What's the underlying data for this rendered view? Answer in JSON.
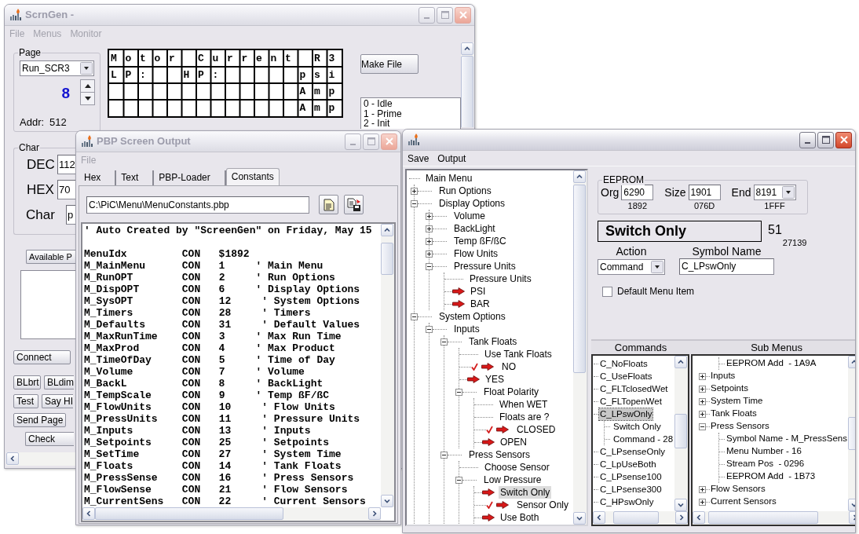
{
  "scrngen": {
    "title": "ScrnGen -",
    "active": false,
    "menu": [
      {
        "label": "File",
        "disabled": true
      },
      {
        "label": "Menus",
        "disabled": true
      },
      {
        "label": "Monitor",
        "disabled": true
      }
    ],
    "page": {
      "label": "Page",
      "value": "Run_SCR3",
      "number": "8",
      "addr_label": "Addr:",
      "addr": "512"
    },
    "lcd": [
      "Motor Current R3",
      "LP:  HP:     psi",
      "             Amp",
      "             Amp"
    ],
    "make_file": "Make File",
    "states": [
      "0 - Idle",
      "1 - Prime",
      "2 - Init"
    ],
    "char": {
      "label": "Char",
      "fields": [
        {
          "label": "DEC",
          "value": "112"
        },
        {
          "label": "HEX",
          "value": "70"
        },
        {
          "label": "Char",
          "value": "p"
        }
      ]
    },
    "available_button": "Available P",
    "buttons": [
      [
        "Connect"
      ],
      [
        "BLbrt",
        "BLdim"
      ],
      [
        "Test",
        "Say HI"
      ],
      [
        "Send Page"
      ],
      [
        "Check"
      ]
    ]
  },
  "pbp_output": {
    "title": "PBP Screen Output",
    "active": false,
    "menu": [
      {
        "label": "File",
        "disabled": true
      }
    ],
    "tabs": [
      {
        "label": "Hex",
        "selected": false
      },
      {
        "label": "Text",
        "selected": false
      },
      {
        "label": "PBP-Loader",
        "selected": false
      },
      {
        "label": "Constants",
        "selected": true
      }
    ],
    "path": "C:\\PiC\\Menu\\MenuConstants.pbp",
    "header": "' Auto Created by \"ScreenGen\" on Friday, May 15",
    "constants": [
      {
        "name": "MenuIdx",
        "keyword": "CON",
        "value": "$1892"
      },
      {
        "name": "M_MainMenu",
        "keyword": "CON",
        "value": "1",
        "comment": "' Main Menu"
      },
      {
        "name": "M_RunOPT",
        "keyword": "CON",
        "value": "2",
        "comment": "' Run Options"
      },
      {
        "name": "M_DispOPT",
        "keyword": "CON",
        "value": "6",
        "comment": "' Display Options"
      },
      {
        "name": "M_SysOPT",
        "keyword": "CON",
        "value": "12",
        "comment": "' System Options"
      },
      {
        "name": "M_Timers",
        "keyword": "CON",
        "value": "28",
        "comment": "' Timers"
      },
      {
        "name": "M_Defaults",
        "keyword": "CON",
        "value": "31",
        "comment": "' Default Values"
      },
      {
        "name": "M_MaxRunTime",
        "keyword": "CON",
        "value": "3",
        "comment": "' Max Run Time"
      },
      {
        "name": "M_MaxProd",
        "keyword": "CON",
        "value": "4",
        "comment": "' Max Product"
      },
      {
        "name": "M_TimeOfDay",
        "keyword": "CON",
        "value": "5",
        "comment": "' Time of Day"
      },
      {
        "name": "M_Volume",
        "keyword": "CON",
        "value": "7",
        "comment": "' Volume"
      },
      {
        "name": "M_BackL",
        "keyword": "CON",
        "value": "8",
        "comment": "' BackLight"
      },
      {
        "name": "M_TempScale",
        "keyword": "CON",
        "value": "9",
        "comment": "' Temp ßF/ßC"
      },
      {
        "name": "M_FlowUnits",
        "keyword": "CON",
        "value": "10",
        "comment": "' Flow Units"
      },
      {
        "name": "M_PressUnits",
        "keyword": "CON",
        "value": "11",
        "comment": "' Pressure Units"
      },
      {
        "name": "M_Inputs",
        "keyword": "CON",
        "value": "13",
        "comment": "' Inputs"
      },
      {
        "name": "M_Setpoints",
        "keyword": "CON",
        "value": "25",
        "comment": "' Setpoints"
      },
      {
        "name": "M_SetTime",
        "keyword": "CON",
        "value": "27",
        "comment": "' System Time"
      },
      {
        "name": "M_Floats",
        "keyword": "CON",
        "value": "14",
        "comment": "' Tank Floats"
      },
      {
        "name": "M_PressSense",
        "keyword": "CON",
        "value": "16",
        "comment": "' Press Sensors"
      },
      {
        "name": "M_FlowSense",
        "keyword": "CON",
        "value": "21",
        "comment": "' Flow Sensors"
      },
      {
        "name": "M_CurrentSens",
        "keyword": "CON",
        "value": "22",
        "comment": "' Current Sensors"
      }
    ]
  },
  "menu_editor": {
    "active": true,
    "menu": [
      {
        "label": "Save",
        "disabled": false
      },
      {
        "label": "Output",
        "disabled": false
      }
    ],
    "tree": [
      {
        "label": "Main Menu",
        "kind": "node",
        "selected": false,
        "children": [
          {
            "label": "Run Options",
            "kind": "node",
            "selected": false,
            "expanded": false
          },
          {
            "label": "Display Options",
            "kind": "node",
            "selected": false,
            "expanded": true,
            "children": [
              {
                "label": "Volume",
                "kind": "node",
                "selected": false,
                "expanded": false
              },
              {
                "label": "BackLight",
                "kind": "node",
                "selected": false,
                "expanded": false
              },
              {
                "label": "Temp ßF/ßC",
                "kind": "node",
                "selected": false,
                "expanded": false
              },
              {
                "label": "Flow Units",
                "kind": "node",
                "selected": false,
                "expanded": false
              },
              {
                "label": "Pressure Units",
                "kind": "node",
                "selected": false,
                "expanded": true,
                "children": [
                  {
                    "label": "Pressure Units",
                    "kind": "node",
                    "selected": false
                  },
                  {
                    "label": "PSI",
                    "kind": "option",
                    "selected": false,
                    "checked": false
                  },
                  {
                    "label": "BAR",
                    "kind": "option",
                    "selected": false,
                    "checked": false
                  }
                ]
              }
            ]
          },
          {
            "label": "System Options",
            "kind": "node",
            "selected": false,
            "expanded": true,
            "children": [
              {
                "label": "Inputs",
                "kind": "node",
                "selected": false,
                "expanded": true,
                "children": [
                  {
                    "label": "Tank Floats",
                    "kind": "node",
                    "selected": false,
                    "expanded": true,
                    "children": [
                      {
                        "label": "Use Tank Floats",
                        "kind": "node",
                        "selected": false
                      },
                      {
                        "label": "NO",
                        "kind": "option",
                        "selected": false,
                        "checked": true
                      },
                      {
                        "label": "YES",
                        "kind": "option",
                        "selected": false,
                        "checked": false
                      },
                      {
                        "label": "Float Polarity",
                        "kind": "node",
                        "selected": false,
                        "expanded": true,
                        "children": [
                          {
                            "label": "When WET",
                            "kind": "node",
                            "selected": false
                          },
                          {
                            "label": "Floats are ?",
                            "kind": "node",
                            "selected": false
                          },
                          {
                            "label": "CLOSED",
                            "kind": "option",
                            "selected": false,
                            "checked": true
                          },
                          {
                            "label": "OPEN",
                            "kind": "option",
                            "selected": false,
                            "checked": false
                          }
                        ]
                      }
                    ]
                  },
                  {
                    "label": "Press Sensors",
                    "kind": "node",
                    "selected": false,
                    "expanded": true,
                    "children": [
                      {
                        "label": "Choose Sensor",
                        "kind": "node",
                        "selected": false
                      },
                      {
                        "label": "Low Pressure",
                        "kind": "node",
                        "selected": false,
                        "expanded": true,
                        "children": [
                          {
                            "label": "Switch Only",
                            "kind": "option",
                            "selected": true,
                            "checked": false
                          },
                          {
                            "label": "Sensor Only",
                            "kind": "option",
                            "selected": false,
                            "checked": true
                          },
                          {
                            "label": "Use Both",
                            "kind": "option",
                            "selected": false,
                            "checked": false
                          }
                        ]
                      }
                    ]
                  }
                ]
              }
            ]
          }
        ]
      }
    ],
    "eeprom": {
      "label": "EEPROM",
      "fields": [
        {
          "label": "Org",
          "value": "6290",
          "hex": "1892",
          "kind": "text"
        },
        {
          "label": "Size",
          "value": "1901",
          "hex": "076D",
          "kind": "text"
        },
        {
          "label": "End",
          "value": "8191",
          "hex": "1FFF",
          "kind": "combo"
        }
      ]
    },
    "caption": "Switch Only",
    "count": "51",
    "code": "27139",
    "action": {
      "label": "Action",
      "value": "Command"
    },
    "symbol": {
      "label": "Symbol Name",
      "value": "C_LPswOnly"
    },
    "default_item": {
      "label": "Default Menu Item",
      "checked": false
    },
    "commands": {
      "label": "Commands",
      "items": [
        {
          "label": "C_NoFloats",
          "selected": false
        },
        {
          "label": "C_UseFloats",
          "selected": false
        },
        {
          "label": "C_FLTclosedWet",
          "selected": false
        },
        {
          "label": "C_FLTopenWet",
          "selected": false
        },
        {
          "label": "C_LPswOnly",
          "selected": true,
          "children": [
            {
              "label": "Switch Only",
              "selected": false
            },
            {
              "label": "Command - 28",
              "selected": false
            }
          ]
        },
        {
          "label": "C_LPsenseOnly",
          "selected": false
        },
        {
          "label": "C_LpUseBoth",
          "selected": false
        },
        {
          "label": "C_LPsense100",
          "selected": false
        },
        {
          "label": "C_LPsense300",
          "selected": false
        },
        {
          "label": "C_HPswOnly",
          "selected": false
        }
      ]
    },
    "sub_menus": {
      "label": "Sub Menus",
      "items": [
        {
          "label": "EEPROM Add  - 1A9A",
          "kind": "detail",
          "selected": false
        },
        {
          "label": "Inputs",
          "kind": "menu",
          "selected": false,
          "expanded": false
        },
        {
          "label": "Setpoints",
          "kind": "menu",
          "selected": false,
          "expanded": false
        },
        {
          "label": "System Time",
          "kind": "menu",
          "selected": false,
          "expanded": false
        },
        {
          "label": "Tank Floats",
          "kind": "menu",
          "selected": false,
          "expanded": false
        },
        {
          "label": "Press Sensors",
          "kind": "menu",
          "selected": false,
          "expanded": true,
          "children": [
            {
              "label": "Symbol Name - M_PressSens",
              "kind": "detail",
              "selected": false
            },
            {
              "label": "Menu Number - 16",
              "kind": "detail",
              "selected": false
            },
            {
              "label": "Stream Pos  - 0296",
              "kind": "detail",
              "selected": false
            },
            {
              "label": "EEPROM Add  - 1B73",
              "kind": "detail",
              "selected": false
            }
          ]
        },
        {
          "label": "Flow Sensors",
          "kind": "menu",
          "selected": false,
          "expanded": false
        },
        {
          "label": "Current Sensors",
          "kind": "menu",
          "selected": false,
          "expanded": false
        }
      ]
    }
  }
}
